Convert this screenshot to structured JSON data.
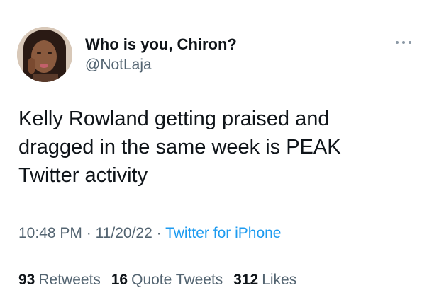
{
  "author": {
    "display_name": "Who is you, Chiron?",
    "handle": "@NotLaja",
    "avatar_icon": "profile-photo"
  },
  "tweet": {
    "text": "Kelly Rowland getting praised and dragged in the same week is PEAK Twitter activity",
    "time": "10:48 PM",
    "separator": "·",
    "date": "11/20/22",
    "source": "Twitter for iPhone"
  },
  "stats": {
    "retweets_count": "93",
    "retweets_label": "Retweets",
    "quote_count": "16",
    "quote_label": "Quote Tweets",
    "likes_count": "312",
    "likes_label": "Likes"
  },
  "colors": {
    "text_primary": "#0f1419",
    "text_secondary": "#536471",
    "link": "#1d9bf0",
    "background": "#ffffff"
  }
}
